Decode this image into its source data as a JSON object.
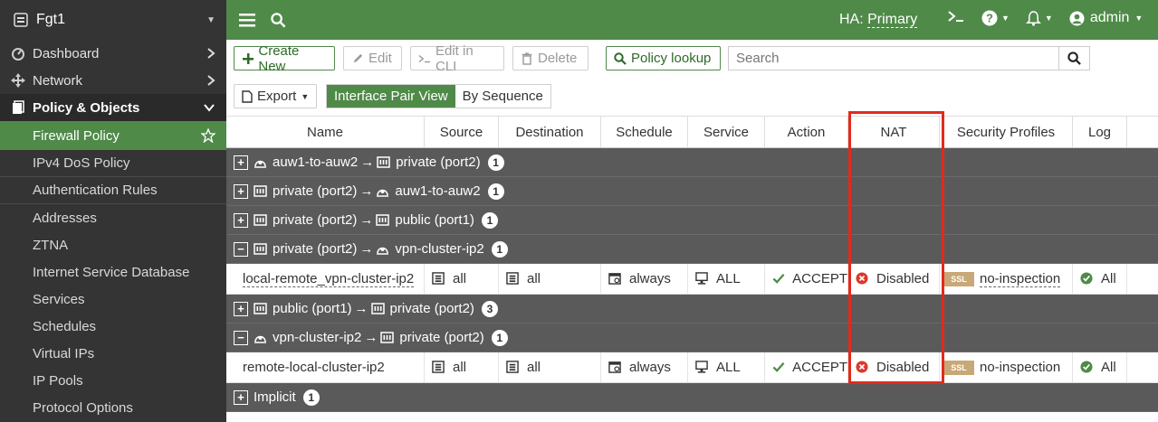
{
  "sidebar": {
    "device": "Fgt1",
    "items": [
      {
        "label": "Dashboard"
      },
      {
        "label": "Network"
      },
      {
        "label": "Policy & Objects"
      }
    ],
    "subitems": [
      {
        "label": "Firewall Policy"
      },
      {
        "label": "IPv4 DoS Policy"
      },
      {
        "label": "Authentication Rules"
      },
      {
        "label": "Addresses"
      },
      {
        "label": "ZTNA"
      },
      {
        "label": "Internet Service Database"
      },
      {
        "label": "Services"
      },
      {
        "label": "Schedules"
      },
      {
        "label": "Virtual IPs"
      },
      {
        "label": "IP Pools"
      },
      {
        "label": "Protocol Options"
      }
    ]
  },
  "topbar": {
    "ha_label": "HA:",
    "ha_role": "Primary",
    "user": "admin"
  },
  "toolbar": {
    "create_new": "Create New",
    "edit": "Edit",
    "edit_in_cli": "Edit in CLI",
    "delete": "Delete",
    "policy_lookup": "Policy lookup",
    "search_placeholder": "Search",
    "export": "Export",
    "view_interface_pair": "Interface Pair View",
    "view_by_sequence": "By Sequence"
  },
  "table": {
    "columns": [
      "Name",
      "Source",
      "Destination",
      "Schedule",
      "Service",
      "Action",
      "NAT",
      "Security Profiles",
      "Log"
    ],
    "groups": [
      {
        "src": "auw1-to-auw2",
        "dst": "private (port2)",
        "count": "1",
        "expanded": false
      },
      {
        "src": "private (port2)",
        "dst": "auw1-to-auw2",
        "count": "1",
        "expanded": false
      },
      {
        "src": "private (port2)",
        "dst": "public (port1)",
        "count": "1",
        "expanded": false
      },
      {
        "src": "private (port2)",
        "dst": "vpn-cluster-ip2",
        "count": "1",
        "expanded": true
      },
      {
        "src": "public (port1)",
        "dst": "private (port2)",
        "count": "3",
        "expanded": false
      },
      {
        "src": "vpn-cluster-ip2",
        "dst": "private (port2)",
        "count": "1",
        "expanded": true
      }
    ],
    "rows": [
      {
        "name": "local-remote_vpn-cluster-ip2",
        "source": "all",
        "destination": "all",
        "schedule": "always",
        "service": "ALL",
        "action": "ACCEPT",
        "nat": "Disabled",
        "ssl": "SSL",
        "profile": "no-inspection",
        "log": "All"
      },
      {
        "name": "remote-local-cluster-ip2",
        "source": "all",
        "destination": "all",
        "schedule": "always",
        "service": "ALL",
        "action": "ACCEPT",
        "nat": "Disabled",
        "ssl": "SSL",
        "profile": "no-inspection",
        "log": "All"
      }
    ],
    "implicit": {
      "label": "Implicit",
      "count": "1"
    },
    "arrow": "→"
  },
  "colors": {
    "accent": "#4f8a49",
    "sidebar": "#343434",
    "highlight": "#e32a1c",
    "group_row": "#5a5a5a"
  }
}
